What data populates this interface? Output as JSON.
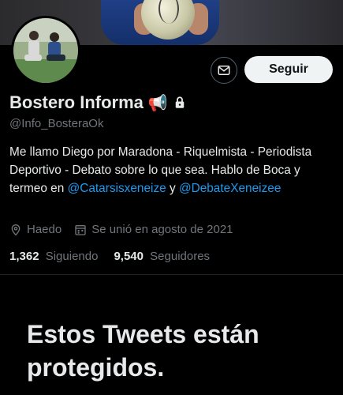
{
  "profile": {
    "name": "Bostero Informa",
    "name_emoji": "📢",
    "handle": "@Info_BosteraOk",
    "bio_text_1": "Me llamo Diego por Maradona - Riquelmista - Periodista Deportivo - Debato sobre lo que sea. Hablo de Boca y termeo en ",
    "bio_link_1": "@Catarsisxeneize",
    "bio_text_2": " y ",
    "bio_link_2": "@DebateXeneizee",
    "location": "Haedo",
    "joined": "Se unió en agosto de 2021"
  },
  "actions": {
    "follow_label": "Seguir"
  },
  "stats": {
    "following_count": "1,362",
    "following_label": "Siguiendo",
    "followers_count": "9,540",
    "followers_label": "Seguidores"
  },
  "protected": {
    "title": "Estos Tweets están protegidos."
  },
  "colors": {
    "background": "#000000",
    "link": "#1d9bf0",
    "secondary_text": "#71767b",
    "follow_button_bg": "#eff3f4"
  },
  "icons": [
    "mail-icon",
    "lock-icon",
    "location-icon",
    "calendar-icon",
    "megaphone-emoji"
  ]
}
